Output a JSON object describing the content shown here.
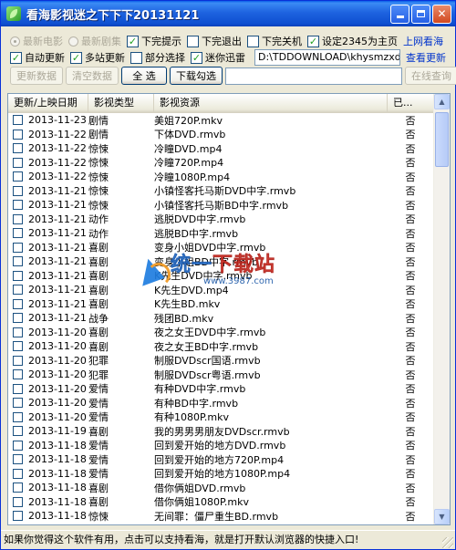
{
  "window": {
    "title": "看海影视迷之下下下20131121",
    "icon": "app-leaf-icon"
  },
  "options": {
    "radio_latest_movie": "最新电影",
    "radio_latest_series": "最新剧集",
    "check_download_notify": "下完提示",
    "check_exit_after": "下完退出",
    "check_shutdown_after": "下完关机",
    "check_set_homepage": "设定2345为主页",
    "link_homepage": "上网看海",
    "check_auto_update": "自动更新",
    "check_multi_site": "多站更新",
    "check_partial_select": "部分选择",
    "check_mini_thunder": "迷你迅雷",
    "download_path": "D:\\TDDOWNLOAD\\khysmzxdy_",
    "link_check_update": "查看更新"
  },
  "toolbar": {
    "update_data": "更新数据",
    "clear_data": "清空数据",
    "select_all": "全    选",
    "download_checked": "下载勾选",
    "search_value": "",
    "online_query": "在线查询"
  },
  "list": {
    "headers": [
      "更新/上映日期",
      "影视类型",
      "影视资源",
      "已..."
    ],
    "rows": [
      {
        "date": "2013-11-23",
        "genre": "剧情",
        "resource": "美姐720P.mkv",
        "done": "否"
      },
      {
        "date": "2013-11-22",
        "genre": "剧情",
        "resource": "下体DVD.rmvb",
        "done": "否"
      },
      {
        "date": "2013-11-22",
        "genre": "惊悚",
        "resource": "冷瞳DVD.mp4",
        "done": "否"
      },
      {
        "date": "2013-11-22",
        "genre": "惊悚",
        "resource": "冷瞳720P.mp4",
        "done": "否"
      },
      {
        "date": "2013-11-22",
        "genre": "惊悚",
        "resource": "冷瞳1080P.mp4",
        "done": "否"
      },
      {
        "date": "2013-11-21",
        "genre": "惊悚",
        "resource": "小镇怪客托马斯DVD中字.rmvb",
        "done": "否"
      },
      {
        "date": "2013-11-21",
        "genre": "惊悚",
        "resource": "小镇怪客托马斯BD中字.rmvb",
        "done": "否"
      },
      {
        "date": "2013-11-21",
        "genre": "动作",
        "resource": "逃脱DVD中字.rmvb",
        "done": "否"
      },
      {
        "date": "2013-11-21",
        "genre": "动作",
        "resource": "逃脱BD中字.rmvb",
        "done": "否"
      },
      {
        "date": "2013-11-21",
        "genre": "喜剧",
        "resource": "变身小姐DVD中字.rmvb",
        "done": "否"
      },
      {
        "date": "2013-11-21",
        "genre": "喜剧",
        "resource": "变身小姐BD中字.rmvb",
        "done": "否"
      },
      {
        "date": "2013-11-21",
        "genre": "喜剧",
        "resource": "K先生DVD中字.rmvb",
        "done": "否"
      },
      {
        "date": "2013-11-21",
        "genre": "喜剧",
        "resource": "K先生DVD.mp4",
        "done": "否"
      },
      {
        "date": "2013-11-21",
        "genre": "喜剧",
        "resource": "K先生BD.mkv",
        "done": "否"
      },
      {
        "date": "2013-11-21",
        "genre": "战争",
        "resource": "残团BD.mkv",
        "done": "否"
      },
      {
        "date": "2013-11-20",
        "genre": "喜剧",
        "resource": "夜之女王DVD中字.rmvb",
        "done": "否"
      },
      {
        "date": "2013-11-20",
        "genre": "喜剧",
        "resource": "夜之女王BD中字.rmvb",
        "done": "否"
      },
      {
        "date": "2013-11-20",
        "genre": "犯罪",
        "resource": "制服DVDscr国语.rmvb",
        "done": "否"
      },
      {
        "date": "2013-11-20",
        "genre": "犯罪",
        "resource": "制服DVDscr粤语.rmvb",
        "done": "否"
      },
      {
        "date": "2013-11-20",
        "genre": "爱情",
        "resource": "有种DVD中字.rmvb",
        "done": "否"
      },
      {
        "date": "2013-11-20",
        "genre": "爱情",
        "resource": "有种BD中字.rmvb",
        "done": "否"
      },
      {
        "date": "2013-11-20",
        "genre": "爱情",
        "resource": "有种1080P.mkv",
        "done": "否"
      },
      {
        "date": "2013-11-19",
        "genre": "喜剧",
        "resource": "我的男男男朋友DVDscr.rmvb",
        "done": "否"
      },
      {
        "date": "2013-11-18",
        "genre": "爱情",
        "resource": "回到爱开始的地方DVD.rmvb",
        "done": "否"
      },
      {
        "date": "2013-11-18",
        "genre": "爱情",
        "resource": "回到爱开始的地方720P.mp4",
        "done": "否"
      },
      {
        "date": "2013-11-18",
        "genre": "爱情",
        "resource": "回到爱开始的地方1080P.mp4",
        "done": "否"
      },
      {
        "date": "2013-11-18",
        "genre": "喜剧",
        "resource": "借你俩姐DVD.rmvb",
        "done": "否"
      },
      {
        "date": "2013-11-18",
        "genre": "喜剧",
        "resource": "借你俩姐1080P.mkv",
        "done": "否"
      },
      {
        "date": "2013-11-18",
        "genre": "惊悚",
        "resource": "无间罪：僵尸重生BD.rmvb",
        "done": "否"
      }
    ]
  },
  "watermark": {
    "main_a": "统一",
    "main_b": "下载站",
    "url": "www.3987.com"
  },
  "status": {
    "text": "如果你觉得这个软件有用，点击可以支持看海，就是打开默认浏览器的快捷入口!"
  }
}
